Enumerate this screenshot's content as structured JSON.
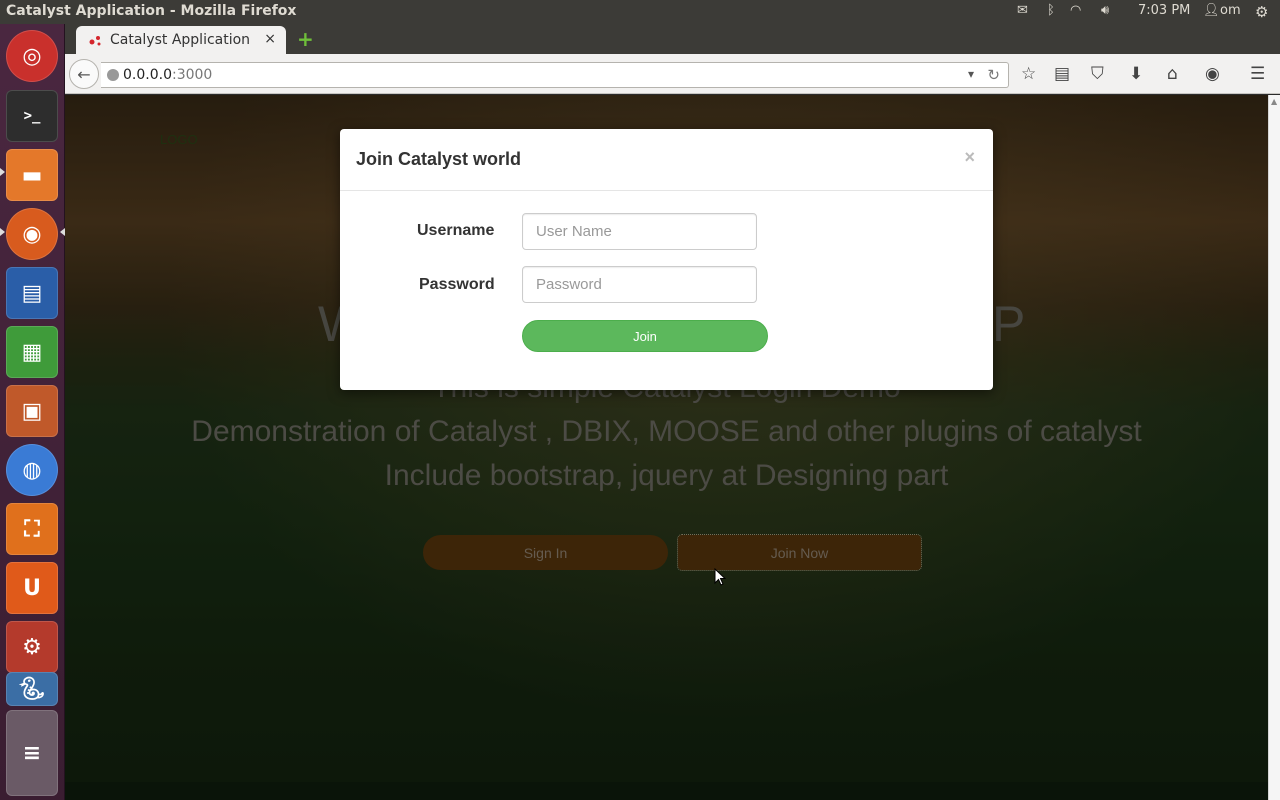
{
  "window": {
    "title": "Catalyst Application - Mozilla Firefox"
  },
  "top_panel": {
    "tray_icons": [
      "mail-icon",
      "bluetooth-icon",
      "wifi-icon",
      "volume-icon",
      "user-icon",
      "settings-gear-icon"
    ],
    "time": "7:03 PM",
    "user": "om"
  },
  "launcher": {
    "items": [
      {
        "name": "ubuntu-dash",
        "color": "#c9302c"
      },
      {
        "name": "terminal",
        "color": "#2d2d2d"
      },
      {
        "name": "files",
        "color": "#e4782a"
      },
      {
        "name": "firefox",
        "color": "#d85b1e"
      },
      {
        "name": "libreoffice-writer",
        "color": "#2a5ea8"
      },
      {
        "name": "libreoffice-calc",
        "color": "#3f9b3a"
      },
      {
        "name": "libreoffice-impress",
        "color": "#c0592a"
      },
      {
        "name": "chromium",
        "color": "#3a7bd5"
      },
      {
        "name": "software-center",
        "color": "#e0701c"
      },
      {
        "name": "ubuntu-one",
        "color": "#e05a1a"
      },
      {
        "name": "system-settings",
        "color": "#b43a2c"
      },
      {
        "name": "python",
        "color": "#3b6ea5"
      }
    ]
  },
  "browser": {
    "tab": {
      "label": "Catalyst Application",
      "close": "×"
    },
    "new_tab": "+",
    "url_host": "0.0.0.0",
    "url_port": ":3000",
    "toolbar_icons": [
      "bookmark-star-icon",
      "reading-list-icon",
      "pocket-icon",
      "download-icon",
      "home-icon",
      "chat-icon",
      "menu-icon"
    ]
  },
  "page": {
    "logo": "LOGO",
    "hero_title_left": "W",
    "hero_title_right": "P",
    "line1": "This is simple Catalyst Login Demo",
    "line2": "Demonstration of Catalyst , DBIX, MOOSE and other plugins of catalyst",
    "line3": "Include bootstrap, jquery at Designing part",
    "sign_in": "Sign In",
    "join_now": "Join Now"
  },
  "modal": {
    "title": "Join Catalyst world",
    "close": "×",
    "username_label": "Username",
    "username_placeholder": "User Name",
    "password_label": "Password",
    "password_placeholder": "Password",
    "submit": "Join"
  },
  "colors": {
    "join_button": "#5cb85c",
    "hero_button": "#5e3a0d",
    "panel": "#3c3b37",
    "launcher": "#3d2034"
  }
}
